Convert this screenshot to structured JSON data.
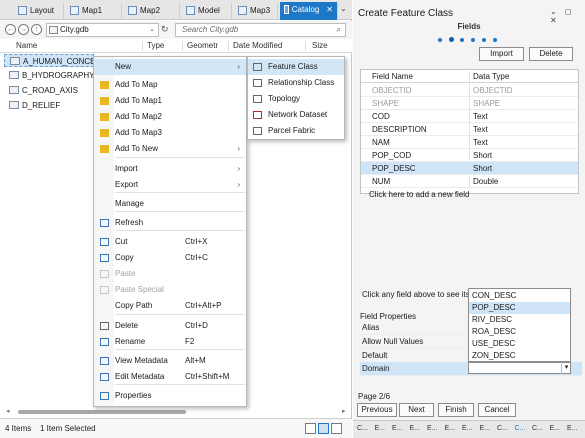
{
  "tabs": [
    {
      "label": "Layout",
      "active": false
    },
    {
      "label": "Map1",
      "active": false
    },
    {
      "label": "Map2",
      "active": false
    },
    {
      "label": "Model",
      "active": false
    },
    {
      "label": "Map3",
      "active": false
    },
    {
      "label": "Catalog",
      "active": true
    }
  ],
  "catalog": {
    "path": "City.gdb",
    "search_placeholder": "Search City.gdb",
    "columns": [
      "Name",
      "Type",
      "Geometr",
      "Date Modified",
      "Size"
    ],
    "items": [
      "A_HUMAN_CONCEN",
      "B_HYDROGRAPHY",
      "C_ROAD_AXIS",
      "D_RELIEF"
    ],
    "status_count": "4 Items",
    "status_selected": "1 Item Selected"
  },
  "context_menu": {
    "items": [
      {
        "label": "New",
        "shortcut": "",
        "submenu": true,
        "disabled": false,
        "highlight": true,
        "icon": ""
      },
      {
        "label": "Add To Map",
        "shortcut": "",
        "submenu": false,
        "disabled": false,
        "icon": "add-layer-icon"
      },
      {
        "label": "Add To Map1",
        "shortcut": "",
        "submenu": false,
        "disabled": false,
        "icon": "add-layer-icon"
      },
      {
        "label": "Add To Map2",
        "shortcut": "",
        "submenu": false,
        "disabled": false,
        "icon": "add-layer-icon"
      },
      {
        "label": "Add To Map3",
        "shortcut": "",
        "submenu": false,
        "disabled": false,
        "icon": "add-layer-icon"
      },
      {
        "label": "Add To New",
        "shortcut": "",
        "submenu": true,
        "disabled": false,
        "icon": "add-layer-icon"
      },
      {
        "label": "Import",
        "shortcut": "",
        "submenu": true,
        "disabled": false,
        "icon": ""
      },
      {
        "label": "Export",
        "shortcut": "",
        "submenu": true,
        "disabled": false,
        "icon": ""
      },
      {
        "label": "Manage",
        "shortcut": "",
        "submenu": false,
        "disabled": false,
        "icon": ""
      },
      {
        "label": "Refresh",
        "shortcut": "",
        "submenu": false,
        "disabled": false,
        "icon": "refresh-icon"
      },
      {
        "label": "Cut",
        "shortcut": "Ctrl+X",
        "submenu": false,
        "disabled": false,
        "icon": "scissors-icon"
      },
      {
        "label": "Copy",
        "shortcut": "Ctrl+C",
        "submenu": false,
        "disabled": false,
        "icon": "copy-icon"
      },
      {
        "label": "Paste",
        "shortcut": "",
        "submenu": false,
        "disabled": true,
        "icon": "paste-icon"
      },
      {
        "label": "Paste Special",
        "shortcut": "",
        "submenu": false,
        "disabled": true,
        "icon": "paste-special-icon"
      },
      {
        "label": "Copy Path",
        "shortcut": "Ctrl+Alt+P",
        "submenu": false,
        "disabled": false,
        "icon": ""
      },
      {
        "label": "Delete",
        "shortcut": "Ctrl+D",
        "submenu": false,
        "disabled": false,
        "icon": "delete-icon"
      },
      {
        "label": "Rename",
        "shortcut": "F2",
        "submenu": false,
        "disabled": false,
        "icon": "rename-icon"
      },
      {
        "label": "View Metadata",
        "shortcut": "Alt+M",
        "submenu": false,
        "disabled": false,
        "icon": "view-metadata-icon"
      },
      {
        "label": "Edit Metadata",
        "shortcut": "Ctrl+Shift+M",
        "submenu": false,
        "disabled": false,
        "icon": "edit-metadata-icon"
      },
      {
        "label": "Properties",
        "shortcut": "",
        "submenu": false,
        "disabled": false,
        "icon": "properties-icon"
      }
    ],
    "submenu": [
      "Feature Class",
      "Relationship Class",
      "Topology",
      "Network Dataset",
      "Parcel Fabric"
    ]
  },
  "panel": {
    "title": "Create Feature Class",
    "step_title": "Fields",
    "import_label": "Import",
    "delete_label": "Delete",
    "grid_headers": [
      "Field Name",
      "Data Type"
    ],
    "fields": [
      {
        "name": "OBJECTID",
        "type": "OBJECTID"
      },
      {
        "name": "SHAPE",
        "type": "SHAPE"
      },
      {
        "name": "COD",
        "type": "Text"
      },
      {
        "name": "DESCRIPTION",
        "type": "Text"
      },
      {
        "name": "NAM",
        "type": "Text"
      },
      {
        "name": "POP_COD",
        "type": "Short"
      },
      {
        "name": "POP_DESC",
        "type": "Short"
      },
      {
        "name": "NUM",
        "type": "Double"
      }
    ],
    "add_field_hint": "Click here to add a new field",
    "properties_hint": "Click any field above to see its pr",
    "field_properties_label": "Field Properties",
    "props": [
      "Alias",
      "Allow Null Values",
      "Default",
      "Domain"
    ],
    "domain_options": [
      "CON_DESC",
      "POP_DESC",
      "RIV_DESC",
      "ROA_DESC",
      "USE_DESC",
      "ZON_DESC"
    ],
    "domain_selected": "POP_DESC",
    "page_label": "Page 2/6",
    "buttons": {
      "previous": "Previous",
      "next": "Next",
      "finish": "Finish",
      "cancel": "Cancel"
    },
    "bottom_tabs": [
      "C...",
      "E...",
      "E...",
      "E...",
      "E...",
      "E...",
      "E...",
      "E...",
      "C...",
      "C...",
      "C...",
      "E...",
      "E..."
    ]
  },
  "colors": {
    "accent": "#1e78c8",
    "selection": "#cfe5f7"
  }
}
